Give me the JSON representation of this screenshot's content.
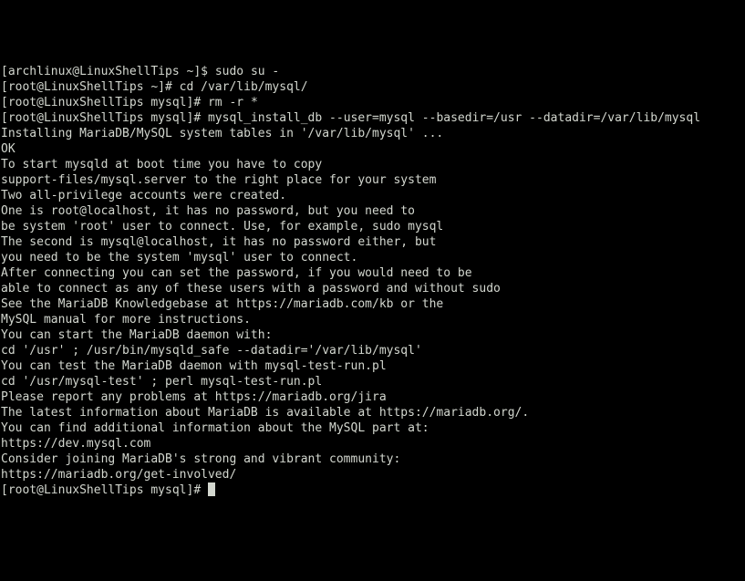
{
  "lines": [
    {
      "prompt": "[archlinux@LinuxShellTips ~]$ ",
      "cmd": "sudo su -"
    },
    {
      "prompt": "[root@LinuxShellTips ~]# ",
      "cmd": "cd /var/lib/mysql/"
    },
    {
      "prompt": "[root@LinuxShellTips mysql]# ",
      "cmd": "rm -r *"
    },
    {
      "prompt": "[root@LinuxShellTips mysql]# ",
      "cmd": "mysql_install_db --user=mysql --basedir=/usr --datadir=/var/lib/mysql"
    }
  ],
  "output": [
    "Installing MariaDB/MySQL system tables in '/var/lib/mysql' ...",
    "OK",
    "",
    "To start mysqld at boot time you have to copy",
    "support-files/mysql.server to the right place for your system",
    "",
    "",
    "Two all-privilege accounts were created.",
    "One is root@localhost, it has no password, but you need to",
    "be system 'root' user to connect. Use, for example, sudo mysql",
    "The second is mysql@localhost, it has no password either, but",
    "you need to be the system 'mysql' user to connect.",
    "After connecting you can set the password, if you would need to be",
    "able to connect as any of these users with a password and without sudo",
    "",
    "See the MariaDB Knowledgebase at https://mariadb.com/kb or the",
    "MySQL manual for more instructions.",
    "",
    "You can start the MariaDB daemon with:",
    "cd '/usr' ; /usr/bin/mysqld_safe --datadir='/var/lib/mysql'",
    "",
    "You can test the MariaDB daemon with mysql-test-run.pl",
    "cd '/usr/mysql-test' ; perl mysql-test-run.pl",
    "",
    "Please report any problems at https://mariadb.org/jira",
    "",
    "The latest information about MariaDB is available at https://mariadb.org/.",
    "You can find additional information about the MySQL part at:",
    "https://dev.mysql.com",
    "Consider joining MariaDB's strong and vibrant community:",
    "https://mariadb.org/get-involved/",
    ""
  ],
  "final_prompt": "[root@LinuxShellTips mysql]# "
}
